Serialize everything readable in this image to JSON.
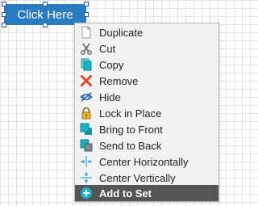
{
  "canvas": {
    "button_label": "Click Here"
  },
  "context_menu": {
    "items": [
      {
        "label": "Duplicate",
        "icon": "duplicate-icon"
      },
      {
        "label": "Cut",
        "icon": "scissors-icon"
      },
      {
        "label": "Copy",
        "icon": "copy-icon"
      },
      {
        "label": "Remove",
        "icon": "remove-x-icon"
      },
      {
        "label": "Hide",
        "icon": "eye-hide-icon"
      },
      {
        "label": "Lock in Place",
        "icon": "lock-icon"
      },
      {
        "label": "Bring to Front",
        "icon": "bring-front-icon"
      },
      {
        "label": "Send to Back",
        "icon": "send-back-icon"
      },
      {
        "label": "Center Horizontally",
        "icon": "center-horizontal-icon"
      },
      {
        "label": "Center Vertically",
        "icon": "center-vertical-icon"
      },
      {
        "label": "Add to Set",
        "icon": "plus-circle-icon",
        "highlighted": true
      }
    ]
  },
  "colors": {
    "button_blue": "#2a7cc0",
    "menu_bg": "#f2f2f2",
    "highlight": "#555555",
    "remove_red": "#e2452f",
    "teal": "#19b3c2"
  }
}
